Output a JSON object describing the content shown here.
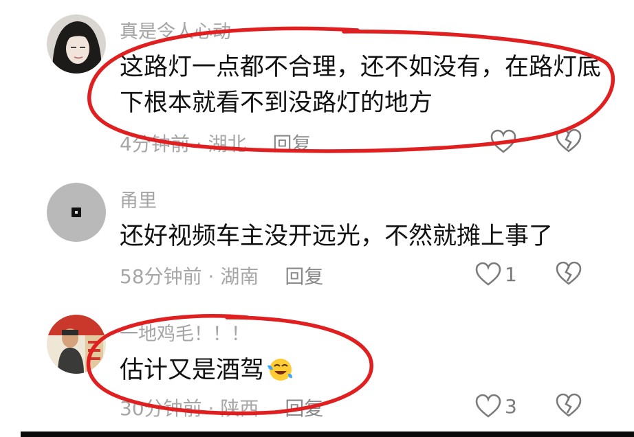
{
  "comments": [
    {
      "username": "真是令人心动",
      "content": "这路灯一点都不合理，还不如没有，在路灯底下根本就看不到没路灯的地方",
      "meta": "4分钟前 · 湖北",
      "reply": "回复",
      "likes": ""
    },
    {
      "username": "甬里",
      "content": "还好视频车主没开远光，不然就摊上事了",
      "meta": "58分钟前 · 湖南",
      "reply": "回复",
      "likes": "1"
    },
    {
      "username": "一地鸡毛！！！",
      "content": "估计又是酒驾",
      "meta": "30分钟前 · 陕西",
      "reply": "回复",
      "likes": "3"
    }
  ],
  "icons": {
    "like": "heart-outline-icon",
    "dislike": "broken-heart-icon",
    "emoji": "crying-laughing-emoji-icon"
  },
  "colors": {
    "annotation": "#e02020",
    "muted_text": "#a6a6a6",
    "primary_text": "#111111"
  }
}
